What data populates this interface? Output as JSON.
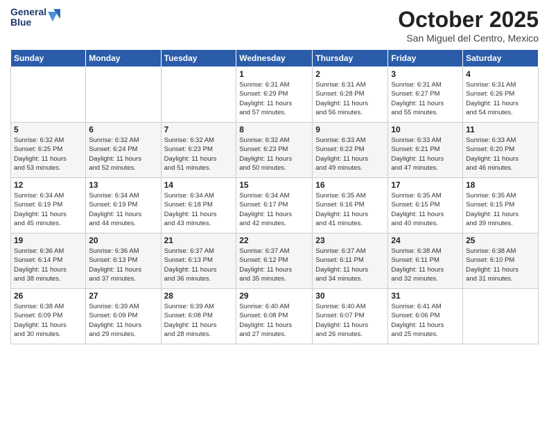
{
  "logo": {
    "line1": "General",
    "line2": "Blue"
  },
  "header": {
    "month": "October 2025",
    "location": "San Miguel del Centro, Mexico"
  },
  "weekdays": [
    "Sunday",
    "Monday",
    "Tuesday",
    "Wednesday",
    "Thursday",
    "Friday",
    "Saturday"
  ],
  "weeks": [
    [
      {
        "day": "",
        "info": ""
      },
      {
        "day": "",
        "info": ""
      },
      {
        "day": "",
        "info": ""
      },
      {
        "day": "1",
        "info": "Sunrise: 6:31 AM\nSunset: 6:29 PM\nDaylight: 11 hours\nand 57 minutes."
      },
      {
        "day": "2",
        "info": "Sunrise: 6:31 AM\nSunset: 6:28 PM\nDaylight: 11 hours\nand 56 minutes."
      },
      {
        "day": "3",
        "info": "Sunrise: 6:31 AM\nSunset: 6:27 PM\nDaylight: 11 hours\nand 55 minutes."
      },
      {
        "day": "4",
        "info": "Sunrise: 6:31 AM\nSunset: 6:26 PM\nDaylight: 11 hours\nand 54 minutes."
      }
    ],
    [
      {
        "day": "5",
        "info": "Sunrise: 6:32 AM\nSunset: 6:25 PM\nDaylight: 11 hours\nand 53 minutes."
      },
      {
        "day": "6",
        "info": "Sunrise: 6:32 AM\nSunset: 6:24 PM\nDaylight: 11 hours\nand 52 minutes."
      },
      {
        "day": "7",
        "info": "Sunrise: 6:32 AM\nSunset: 6:23 PM\nDaylight: 11 hours\nand 51 minutes."
      },
      {
        "day": "8",
        "info": "Sunrise: 6:32 AM\nSunset: 6:23 PM\nDaylight: 11 hours\nand 50 minutes."
      },
      {
        "day": "9",
        "info": "Sunrise: 6:33 AM\nSunset: 6:22 PM\nDaylight: 11 hours\nand 49 minutes."
      },
      {
        "day": "10",
        "info": "Sunrise: 6:33 AM\nSunset: 6:21 PM\nDaylight: 11 hours\nand 47 minutes."
      },
      {
        "day": "11",
        "info": "Sunrise: 6:33 AM\nSunset: 6:20 PM\nDaylight: 11 hours\nand 46 minutes."
      }
    ],
    [
      {
        "day": "12",
        "info": "Sunrise: 6:34 AM\nSunset: 6:19 PM\nDaylight: 11 hours\nand 45 minutes."
      },
      {
        "day": "13",
        "info": "Sunrise: 6:34 AM\nSunset: 6:19 PM\nDaylight: 11 hours\nand 44 minutes."
      },
      {
        "day": "14",
        "info": "Sunrise: 6:34 AM\nSunset: 6:18 PM\nDaylight: 11 hours\nand 43 minutes."
      },
      {
        "day": "15",
        "info": "Sunrise: 6:34 AM\nSunset: 6:17 PM\nDaylight: 11 hours\nand 42 minutes."
      },
      {
        "day": "16",
        "info": "Sunrise: 6:35 AM\nSunset: 6:16 PM\nDaylight: 11 hours\nand 41 minutes."
      },
      {
        "day": "17",
        "info": "Sunrise: 6:35 AM\nSunset: 6:15 PM\nDaylight: 11 hours\nand 40 minutes."
      },
      {
        "day": "18",
        "info": "Sunrise: 6:35 AM\nSunset: 6:15 PM\nDaylight: 11 hours\nand 39 minutes."
      }
    ],
    [
      {
        "day": "19",
        "info": "Sunrise: 6:36 AM\nSunset: 6:14 PM\nDaylight: 11 hours\nand 38 minutes."
      },
      {
        "day": "20",
        "info": "Sunrise: 6:36 AM\nSunset: 6:13 PM\nDaylight: 11 hours\nand 37 minutes."
      },
      {
        "day": "21",
        "info": "Sunrise: 6:37 AM\nSunset: 6:13 PM\nDaylight: 11 hours\nand 36 minutes."
      },
      {
        "day": "22",
        "info": "Sunrise: 6:37 AM\nSunset: 6:12 PM\nDaylight: 11 hours\nand 35 minutes."
      },
      {
        "day": "23",
        "info": "Sunrise: 6:37 AM\nSunset: 6:11 PM\nDaylight: 11 hours\nand 34 minutes."
      },
      {
        "day": "24",
        "info": "Sunrise: 6:38 AM\nSunset: 6:11 PM\nDaylight: 11 hours\nand 32 minutes."
      },
      {
        "day": "25",
        "info": "Sunrise: 6:38 AM\nSunset: 6:10 PM\nDaylight: 11 hours\nand 31 minutes."
      }
    ],
    [
      {
        "day": "26",
        "info": "Sunrise: 6:38 AM\nSunset: 6:09 PM\nDaylight: 11 hours\nand 30 minutes."
      },
      {
        "day": "27",
        "info": "Sunrise: 6:39 AM\nSunset: 6:09 PM\nDaylight: 11 hours\nand 29 minutes."
      },
      {
        "day": "28",
        "info": "Sunrise: 6:39 AM\nSunset: 6:08 PM\nDaylight: 11 hours\nand 28 minutes."
      },
      {
        "day": "29",
        "info": "Sunrise: 6:40 AM\nSunset: 6:08 PM\nDaylight: 11 hours\nand 27 minutes."
      },
      {
        "day": "30",
        "info": "Sunrise: 6:40 AM\nSunset: 6:07 PM\nDaylight: 11 hours\nand 26 minutes."
      },
      {
        "day": "31",
        "info": "Sunrise: 6:41 AM\nSunset: 6:06 PM\nDaylight: 11 hours\nand 25 minutes."
      },
      {
        "day": "",
        "info": ""
      }
    ]
  ]
}
